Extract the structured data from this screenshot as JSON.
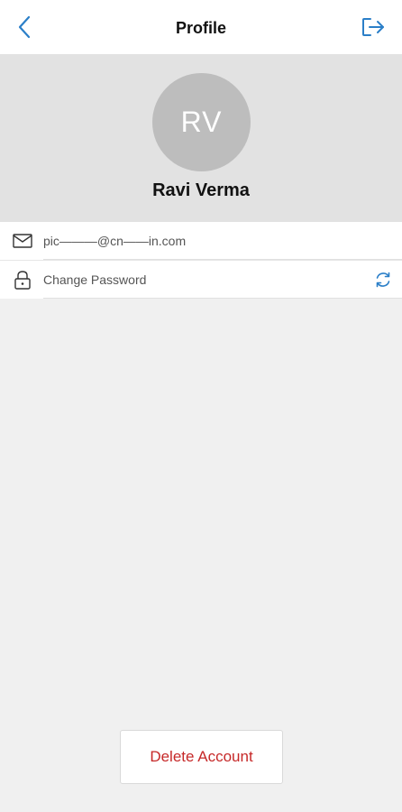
{
  "header": {
    "title": "Profile"
  },
  "profile": {
    "initials": "RV",
    "name": "Ravi Verma"
  },
  "details": {
    "email": "pic———@cn——in.com",
    "change_password_label": "Change Password"
  },
  "actions": {
    "delete_label": "Delete Account"
  },
  "icons": {
    "back": "chevron-left-icon",
    "logout": "logout-icon",
    "email": "mail-icon",
    "password": "lock-icon",
    "refresh": "refresh-icon"
  },
  "colors": {
    "accent": "#2b7fc8",
    "danger": "#c62828",
    "avatar_bg": "#bdbdbd",
    "header_bg": "#e2e2e2",
    "page_bg": "#f0f0f0"
  }
}
